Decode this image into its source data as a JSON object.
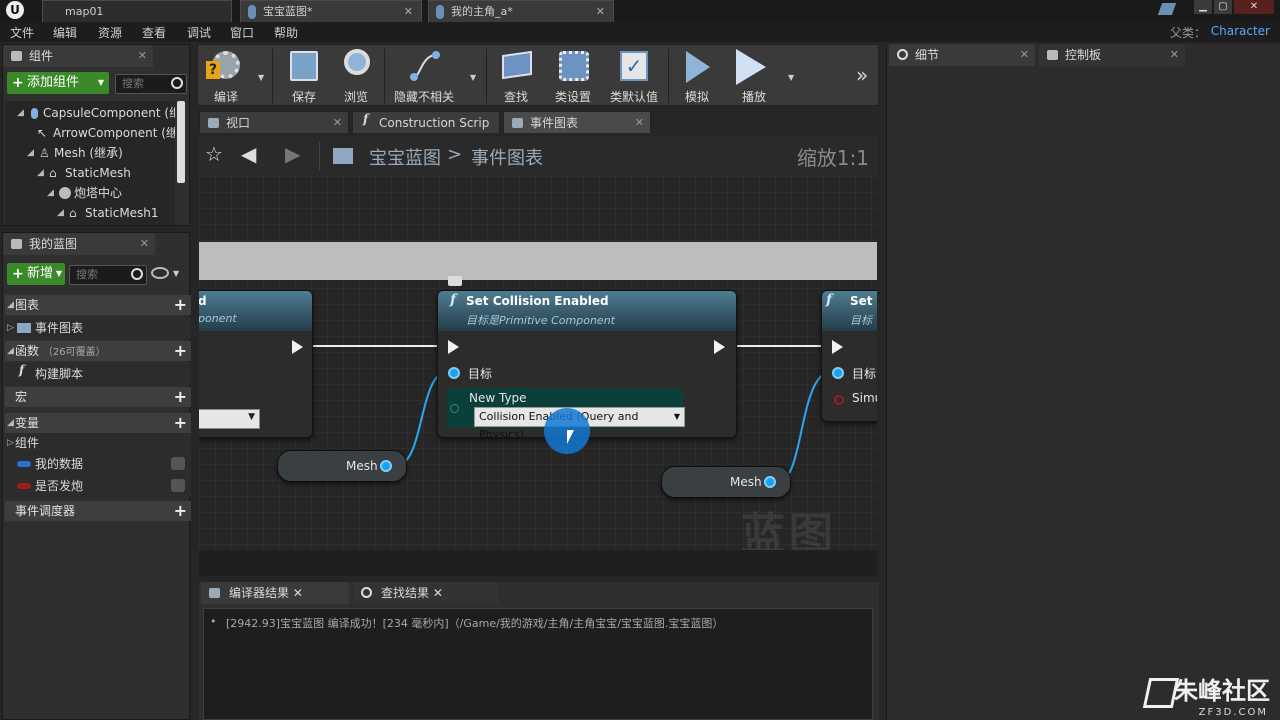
{
  "titlebar": {
    "tabs": [
      {
        "label": "map01"
      },
      {
        "label": "宝宝蓝图*"
      },
      {
        "label": "我的主角_a*"
      }
    ]
  },
  "menu": [
    "文件",
    "编辑",
    "资源",
    "查看",
    "调试",
    "窗口",
    "帮助"
  ],
  "parent_class": {
    "label": "父类：",
    "value": "Character"
  },
  "components_panel": {
    "tab_label": "组件",
    "add_button": "添加组件",
    "search_placeholder": "搜索",
    "tree": [
      "CapsuleComponent (继承",
      "ArrowComponent (继承",
      "Mesh (继承)",
      "StaticMesh",
      "炮塔中心",
      "StaticMesh1"
    ]
  },
  "my_blueprint": {
    "tab_label": "我的蓝图",
    "new_button": "新增",
    "search_placeholder": "搜索",
    "sections": {
      "graphs": "图表",
      "event_graph": "事件图表",
      "functions": "函数",
      "functions_count": "（26可覆盖）",
      "construction_script": "构建脚本",
      "macros": "宏",
      "variables": "变量",
      "components": "组件",
      "var_mydata": "我的数据",
      "var_fire": "是否发炮",
      "event_dispatchers": "事件调度器"
    },
    "colors": {
      "var_mydata": "#2a6fd8",
      "var_fire": "#a11b1b"
    }
  },
  "toolbar": {
    "compile": "编译",
    "save": "保存",
    "browse": "浏览",
    "hide_unrelated": "隐藏不相关",
    "find": "查找",
    "class_settings": "类设置",
    "class_defaults": "类默认值",
    "simulate": "模拟",
    "play": "播放"
  },
  "editor_tabs": {
    "viewport": "视口",
    "construction": "Construction Scrip",
    "event_graph": "事件图表"
  },
  "graph_header": {
    "crumb_root": "宝宝蓝图",
    "crumb_sep": ">",
    "crumb_current": "事件图表",
    "zoom": "缩放1:1"
  },
  "nodes": {
    "left_node_sub_fragment": "ponent",
    "left_node_title_fragment": "d",
    "center": {
      "title": "Set Collision Enabled",
      "subtitle_prefix": "目标是",
      "subtitle_target": "Primitive Component",
      "pin_target": "目标",
      "pin_new_type": "New Type",
      "enum_value": "Collision Enabled (Query and Physics)"
    },
    "right": {
      "title": "Set S",
      "sub": "目标",
      "pin_target": "目标",
      "pin_sim": "Simu"
    },
    "var_mesh_1": "Mesh",
    "var_mesh_2": "Mesh",
    "watermark": "蓝图"
  },
  "results": {
    "tab_compiler": "编译器结果",
    "tab_find": "查找结果",
    "line": "[2942.93]宝宝蓝图 编译成功！[234 毫秒内]（/Game/我的游戏/主角/主角宝宝/宝宝蓝图.宝宝蓝图）"
  },
  "details": {
    "tab_details": "细节",
    "tab_palette": "控制板"
  },
  "site_logo": {
    "text": "朱峰社区",
    "sub": "ZF3D.COM"
  }
}
